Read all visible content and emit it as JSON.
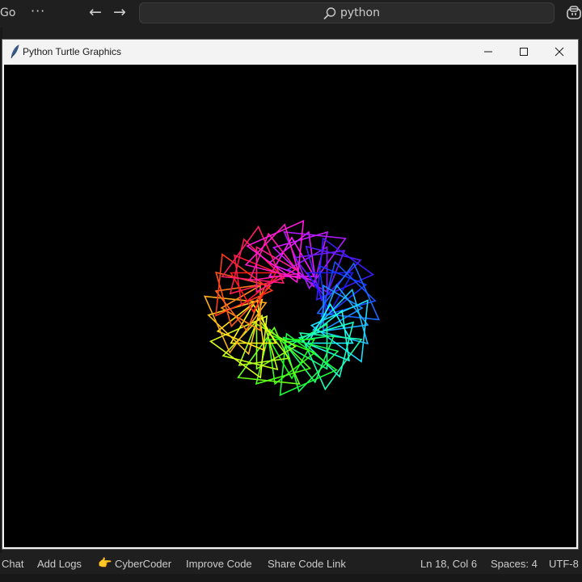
{
  "topbar": {
    "menu_go": "Go",
    "menu_more": "···",
    "back": "←",
    "forward": "→",
    "command_center_text": "python"
  },
  "turtle_window": {
    "title": "Python Turtle Graphics",
    "canvas_background": "#000000"
  },
  "statusbar": {
    "chat": "Chat",
    "add_logs": "Add Logs",
    "hand": "👉",
    "cybercoder": "CyberCoder",
    "improve_code": "Improve Code",
    "share_code_link": "Share Code Link",
    "position": "Ln 18, Col 6",
    "spaces": "Spaces: 4",
    "encoding": "UTF-8"
  },
  "icons": {
    "search": "search-icon",
    "copilot": "copilot-icon",
    "feather": "feather-icon",
    "minimize": "minimize-icon",
    "maximize": "maximize-icon",
    "close": "close-icon"
  }
}
